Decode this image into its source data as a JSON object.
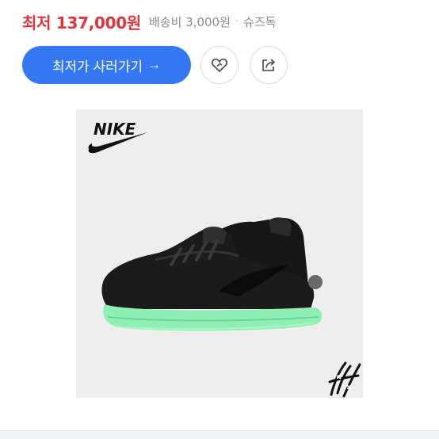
{
  "price": {
    "lowest": "최저 137,000원",
    "shipping": "배송비 3,000원",
    "separator": "·",
    "store": "슈즈독"
  },
  "actions": {
    "cta_label": "최저가 사러가기",
    "cta_arrow": "→"
  },
  "product": {
    "brand_logo_text": "NIKE"
  },
  "icons": {
    "like": "heart-icon",
    "share": "share-icon",
    "expand": "expand-icon"
  },
  "colors": {
    "price": "#e0333b",
    "cta": "#3478f6",
    "image_bg": "#eeeeee",
    "sole": "#8ff0b3"
  }
}
